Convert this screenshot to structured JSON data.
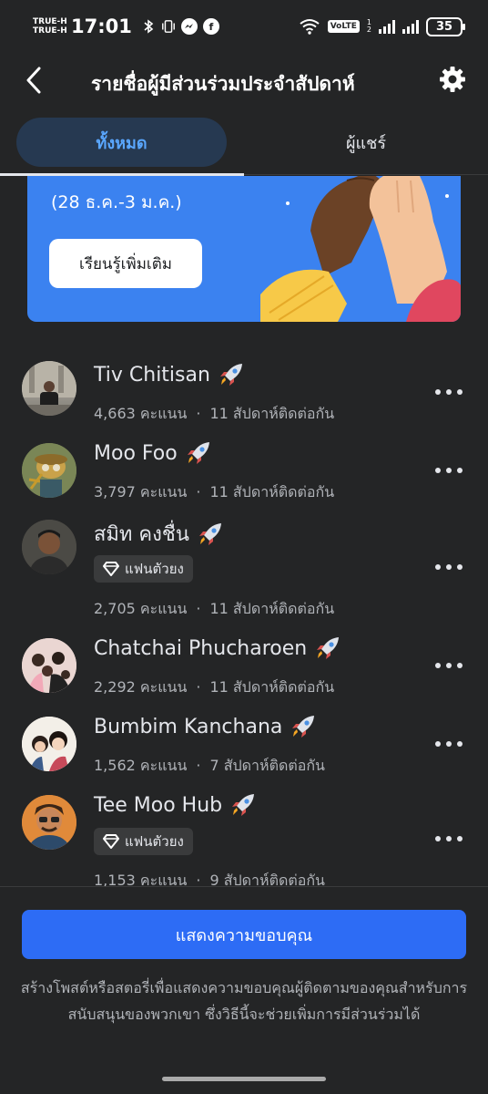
{
  "status_bar": {
    "carrier_1": "TRUE-H",
    "carrier_2": "TRUE-H",
    "time": "17:01",
    "sim_label_1": "1",
    "sim_label_2": "2",
    "volte": "VoLTE",
    "battery": "35"
  },
  "header": {
    "title": "รายชื่อผู้มีส่วนร่วมประจำสัปดาห์"
  },
  "tabs": [
    {
      "label": "ทั้งหมด",
      "active": true
    },
    {
      "label": "ผู้แชร์",
      "active": false
    }
  ],
  "banner": {
    "dates": "(28 ธ.ค.-3 ม.ค.)",
    "button_label": "เรียนรู้เพิ่มเติม"
  },
  "contributors": [
    {
      "name": "Tiv Chitisan",
      "points": "4,663 คะแนน",
      "streak": "11 สัปดาห์ติดต่อกัน",
      "badge": ""
    },
    {
      "name": "Moo Foo",
      "points": "3,797 คะแนน",
      "streak": "11 สัปดาห์ติดต่อกัน",
      "badge": ""
    },
    {
      "name": "สมิท คงชื่น",
      "points": "2,705 คะแนน",
      "streak": "11 สัปดาห์ติดต่อกัน",
      "badge": "แฟนตัวยง"
    },
    {
      "name": "Chatchai Phucharoen",
      "points": "2,292 คะแนน",
      "streak": "11 สัปดาห์ติดต่อกัน",
      "badge": ""
    },
    {
      "name": "Bumbim Kanchana",
      "points": "1,562 คะแนน",
      "streak": "7 สัปดาห์ติดต่อกัน",
      "badge": ""
    },
    {
      "name": "Tee Moo Hub",
      "points": "1,153 คะแนน",
      "streak": "9 สัปดาห์ติดต่อกัน",
      "badge": "แฟนตัวยง"
    }
  ],
  "stats_separator": "·",
  "footer": {
    "button_label": "แสดงความขอบคุณ",
    "description": "สร้างโพสต์หรือสตอรี่เพื่อแสดงความขอบคุณผู้ติดตามของคุณสำหรับการสนับสนุนของพวกเขา ซึ่งวิธีนี้จะช่วยเพิ่มการมีส่วนร่วมได้"
  },
  "colors": {
    "background": "#242526",
    "accent_blue": "#2d6cf5",
    "tab_active_bg": "#263951",
    "tab_active_text": "#5aa7ff",
    "banner_blue": "#3b82f0"
  },
  "icons": {
    "back": "chevron-left-icon",
    "settings": "gear-icon",
    "rocket": "rocket-icon",
    "badge": "diamond-icon",
    "more": "more-dots-icon"
  }
}
